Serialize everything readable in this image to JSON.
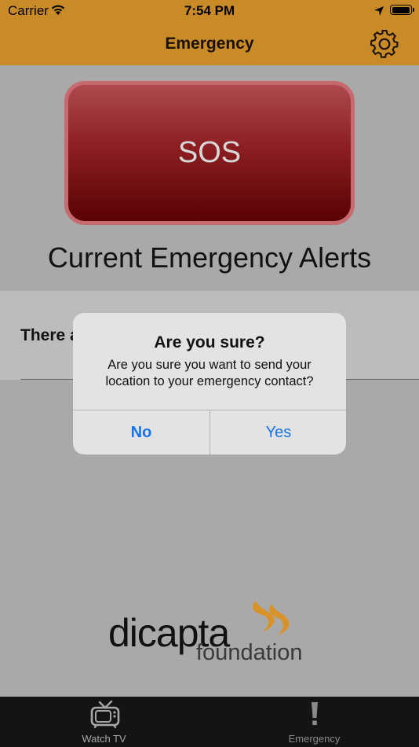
{
  "status": {
    "carrier": "Carrier",
    "time": "7:54 PM"
  },
  "nav": {
    "title": "Emergency",
    "settings_icon": "gear-icon"
  },
  "sos": {
    "label": "SOS"
  },
  "alerts": {
    "heading": "Current Emergency Alerts",
    "row_text": "There a"
  },
  "dialog": {
    "title": "Are you sure?",
    "message": "Are you sure you want to send your location to your emergency contact?",
    "no_label": "No",
    "yes_label": "Yes"
  },
  "logo": {
    "word1": "dicapta",
    "word2": "foundation"
  },
  "tabs": [
    {
      "label": "Watch TV",
      "icon": "tv-icon"
    },
    {
      "label": "Emergency",
      "icon": "exclamation-icon"
    }
  ],
  "colors": {
    "header": "#c98a28",
    "sos_top": "#ad4a4e",
    "sos_bottom": "#5a0204",
    "link": "#1773e6",
    "logo_accent": "#d7922a"
  }
}
